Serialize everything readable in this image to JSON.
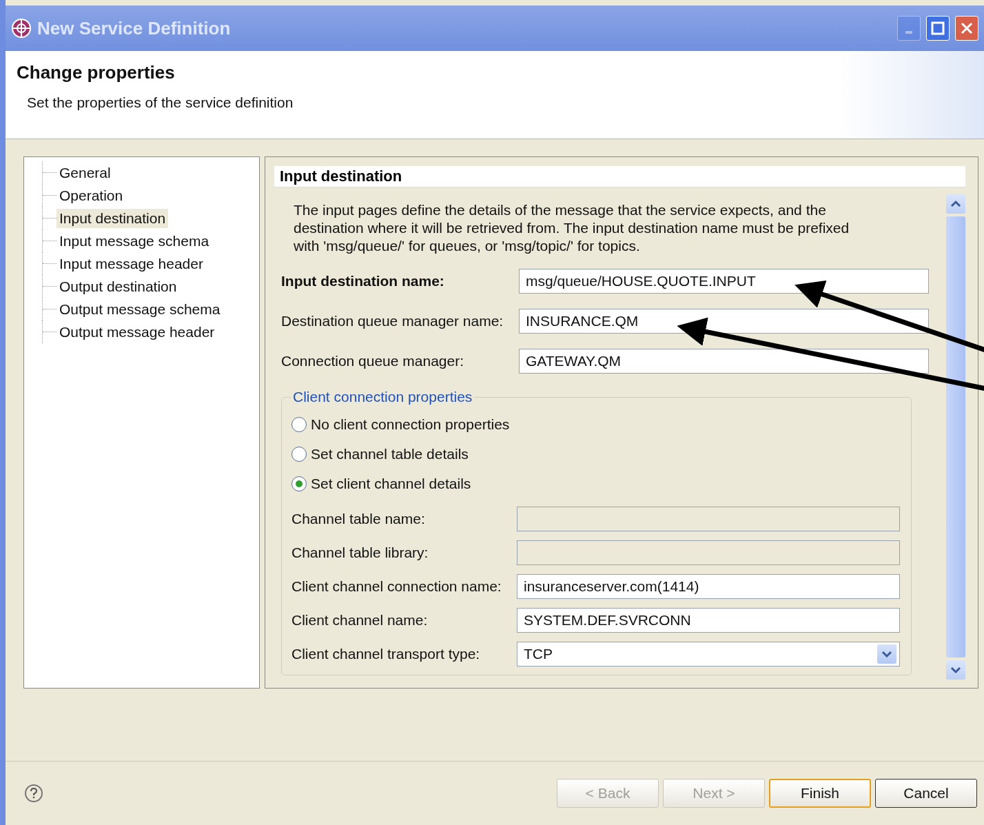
{
  "window": {
    "title": "New Service Definition",
    "controls": [
      {
        "kind": "minimize",
        "disabled": true
      },
      {
        "kind": "maximize",
        "disabled": false
      },
      {
        "kind": "close",
        "disabled": false
      }
    ]
  },
  "header": {
    "title": "Change properties",
    "description": "Set the properties of the service definition"
  },
  "nav": {
    "items": [
      {
        "label": "General",
        "selected": false
      },
      {
        "label": "Operation",
        "selected": false
      },
      {
        "label": "Input destination",
        "selected": true
      },
      {
        "label": "Input message schema",
        "selected": false
      },
      {
        "label": "Input message header",
        "selected": false
      },
      {
        "label": "Output destination",
        "selected": false
      },
      {
        "label": "Output message schema",
        "selected": false
      },
      {
        "label": "Output message header",
        "selected": false
      }
    ]
  },
  "section": {
    "title": "Input destination",
    "description": "The input pages define the details of the message that the service expects, and the destination where it will be retrieved from. The input destination name must be prefixed with 'msg/queue/' for queues, or 'msg/topic/' for topics.",
    "fields": [
      {
        "label": "Input destination name:",
        "value": "msg/queue/HOUSE.QUOTE.INPUT",
        "bold": true
      },
      {
        "label": "Destination queue manager name:",
        "value": "INSURANCE.QM",
        "bold": false
      },
      {
        "label": "Connection queue manager:",
        "value": "GATEWAY.QM",
        "bold": false
      }
    ],
    "client_group": {
      "title": "Client connection properties",
      "options": [
        {
          "label": "No client connection properties",
          "selected": false
        },
        {
          "label": "Set channel table details",
          "selected": false
        },
        {
          "label": "Set client channel details",
          "selected": true
        }
      ],
      "fields": [
        {
          "label": "Channel table name:",
          "kind": "text",
          "disabled": true
        },
        {
          "label": "Channel table library:",
          "kind": "text",
          "disabled": true
        },
        {
          "label": "Client channel connection name:",
          "kind": "text",
          "value": "insuranceserver.com(1414)",
          "disabled": false
        },
        {
          "label": "Client channel name:",
          "kind": "text",
          "value": "SYSTEM.DEF.SVRCONN",
          "disabled": false
        },
        {
          "label": "Client channel transport type:",
          "kind": "select",
          "value": "TCP",
          "disabled": false
        }
      ]
    }
  },
  "footer": {
    "buttons": [
      {
        "label": "< Back",
        "disabled": true,
        "default": false
      },
      {
        "label": "Next >",
        "disabled": true,
        "default": false
      },
      {
        "label": "Finish",
        "disabled": false,
        "default": true
      },
      {
        "label": "Cancel",
        "disabled": false,
        "default": false
      }
    ]
  }
}
